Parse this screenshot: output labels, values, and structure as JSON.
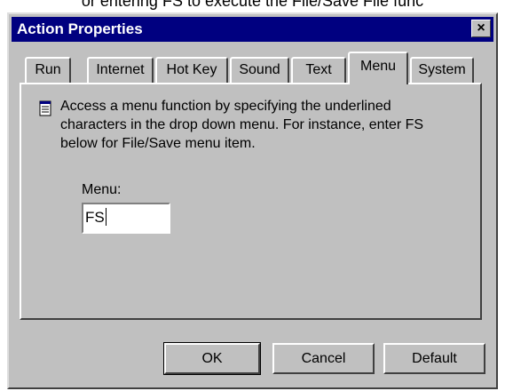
{
  "caption": "or entering FS to execute the File/Save File func",
  "window": {
    "title": "Action Properties",
    "close_label": "×"
  },
  "tabs": [
    {
      "label": "Run",
      "active": false
    },
    {
      "label": "Internet",
      "active": false
    },
    {
      "label": "Hot Key",
      "active": false
    },
    {
      "label": "Sound",
      "active": false
    },
    {
      "label": "Text",
      "active": false
    },
    {
      "label": "Menu",
      "active": true
    },
    {
      "label": "System",
      "active": false
    }
  ],
  "panel": {
    "description_lines": [
      "Access a menu function by specifying the underlined",
      "characters in the drop down menu. For instance, enter FS",
      "below for File/Save menu item."
    ],
    "menu_label": "Menu:",
    "menu_value": "FS"
  },
  "buttons": {
    "ok": "OK",
    "cancel": "Cancel",
    "default": "Default"
  },
  "icon": "document-info-icon"
}
